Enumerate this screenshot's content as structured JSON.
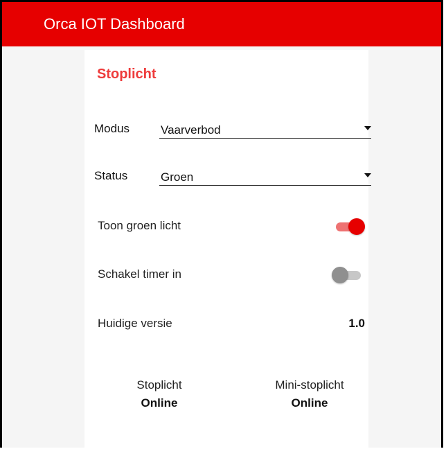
{
  "app": {
    "title": "Orca IOT Dashboard"
  },
  "card": {
    "title": "Stoplicht",
    "modus": {
      "label": "Modus",
      "value": "Vaarverbod"
    },
    "status": {
      "label": "Status",
      "value": "Groen"
    },
    "toggles": [
      {
        "label": "Toon groen licht",
        "state": "on"
      },
      {
        "label": "Schakel timer in",
        "state": "off"
      }
    ],
    "version": {
      "label": "Huidige versie",
      "value": "1.0"
    },
    "devices": [
      {
        "name": "Stoplicht",
        "status": "Online"
      },
      {
        "name": "Mini-stoplicht",
        "status": "Online"
      }
    ]
  },
  "colors": {
    "appbar": "#e60000",
    "accent": "#ee3b3b",
    "toggle_on_knob": "#e60000",
    "toggle_on_track": "#ee7272",
    "toggle_off_knob": "#8f8f8f",
    "toggle_off_track": "#c7c7c7"
  },
  "icons": {
    "select_caret": "caret-down-icon"
  }
}
